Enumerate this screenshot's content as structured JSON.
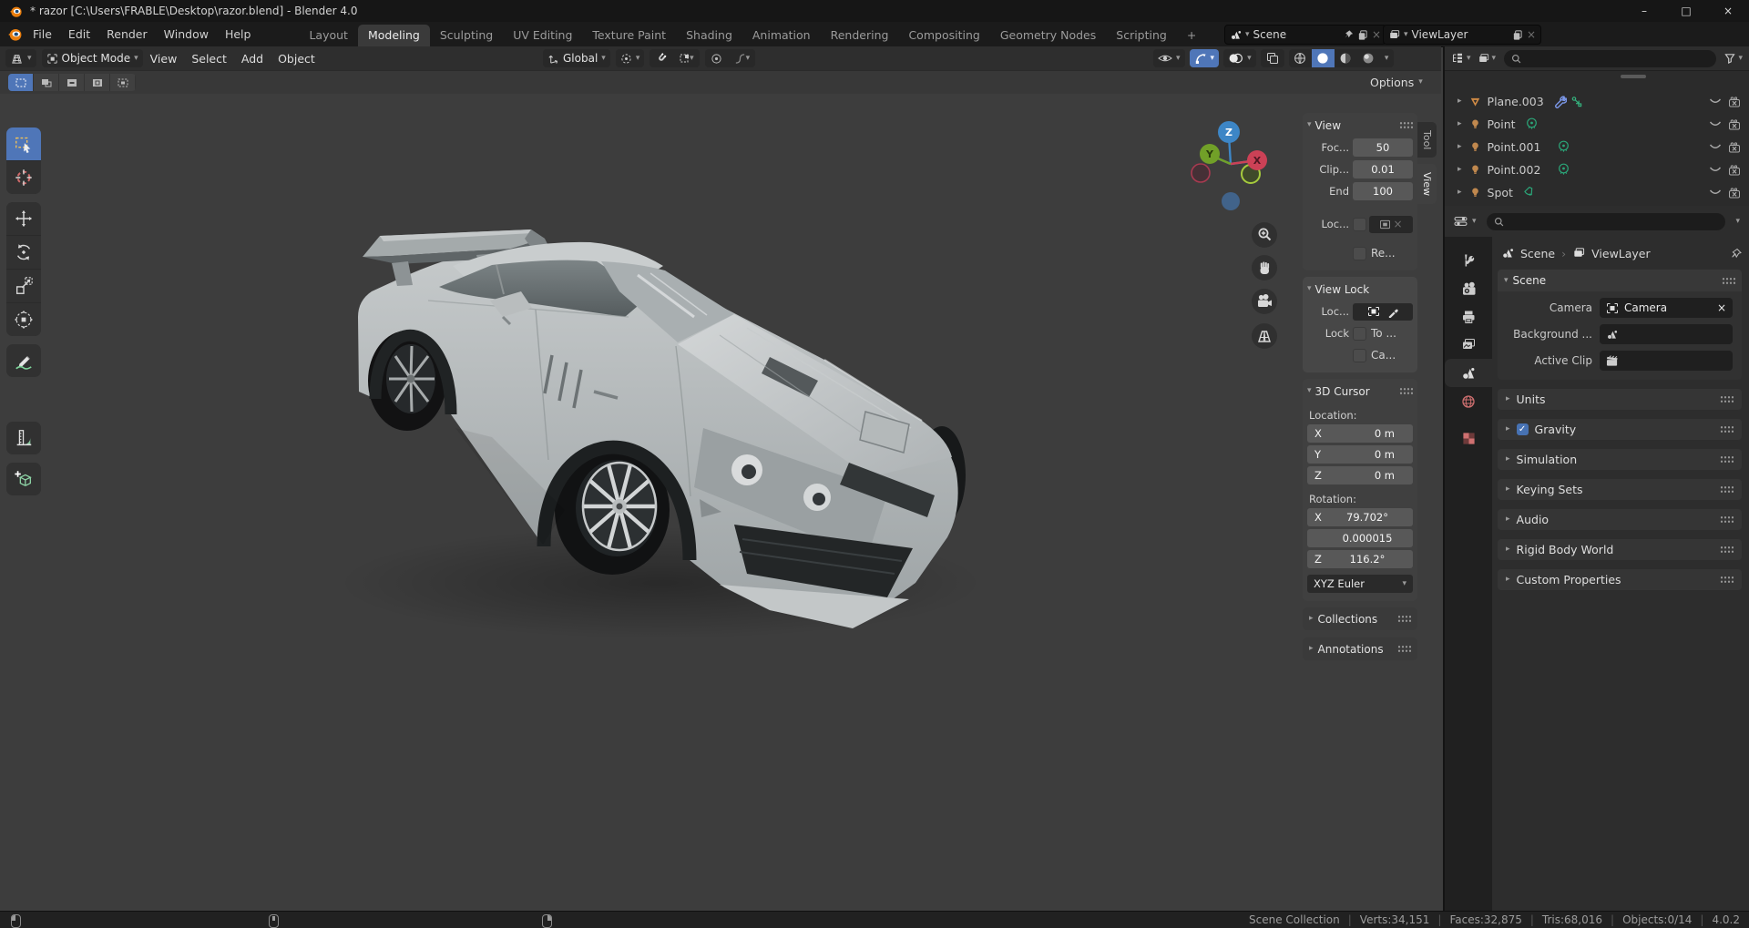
{
  "icons": {
    "chevron_down": "▾",
    "disclosure_right": "▸",
    "disclosure_down": "▾",
    "breadcrumb_separator": "›",
    "close": "×",
    "plus_tab": "+",
    "minimize": "–",
    "maximize": "□",
    "check": "✓",
    "statusbar_separator": "|"
  },
  "titlebar": {
    "title": "* razor [C:\\Users\\FRABLE\\Desktop\\razor.blend] - Blender 4.0"
  },
  "topbar": {
    "menus": [
      "File",
      "Edit",
      "Render",
      "Window",
      "Help"
    ],
    "workspaces": [
      "Layout",
      "Modeling",
      "Sculpting",
      "UV Editing",
      "Texture Paint",
      "Shading",
      "Animation",
      "Rendering",
      "Compositing",
      "Geometry Nodes",
      "Scripting"
    ],
    "active_workspace": "Modeling",
    "scene_selector": "Scene",
    "viewlayer_selector": "ViewLayer"
  },
  "tool_header": {
    "mode": "Object Mode",
    "menus": [
      "View",
      "Select",
      "Add",
      "Object"
    ],
    "orientation": "Global"
  },
  "tool_settings": {
    "options_label": "Options"
  },
  "viewport": {
    "sidebar_tabs": [
      "Tool",
      "View"
    ],
    "active_sidebar_tab": "View",
    "gizmo_axes": {
      "x": "X",
      "y": "Y",
      "z": "Z"
    }
  },
  "sidebar": {
    "view_panel": {
      "title": "View",
      "focal_label": "Foc...",
      "focal_value": "50",
      "clip_label": "Clip...",
      "clip_value": "0.01",
      "end_label": "End",
      "end_value": "100",
      "local_camera_label": "Loc...",
      "render_region_label": "Re..."
    },
    "view_lock_panel": {
      "title": "View Lock",
      "lock_object_label": "Loc...",
      "lock_label": "Lock",
      "to_3d_cursor_label": "To ...",
      "camera_to_view_label": "Ca..."
    },
    "cursor_panel": {
      "title": "3D Cursor",
      "location_label": "Location:",
      "location": [
        {
          "axis": "X",
          "value": "0 m"
        },
        {
          "axis": "Y",
          "value": "0 m"
        },
        {
          "axis": "Z",
          "value": "0 m"
        }
      ],
      "rotation_label": "Rotation:",
      "rotation": [
        {
          "axis": "X",
          "value": "79.702°"
        },
        {
          "axis": "",
          "value": "0.000015"
        },
        {
          "axis": "Z",
          "value": "116.2°"
        }
      ],
      "rotation_mode": "XYZ Euler"
    },
    "collections_panel": "Collections",
    "annotations_panel": "Annotations"
  },
  "outliner": {
    "items": [
      {
        "name": "Plane.003",
        "type": "mesh"
      },
      {
        "name": "Point",
        "type": "light"
      },
      {
        "name": "Point.001",
        "type": "light"
      },
      {
        "name": "Point.002",
        "type": "light"
      },
      {
        "name": "Spot",
        "type": "light"
      }
    ]
  },
  "properties": {
    "breadcrumb": {
      "scene": "Scene",
      "view_layer": "ViewLayer"
    },
    "scene_panel": {
      "title": "Scene",
      "camera_label": "Camera",
      "camera_value": "Camera",
      "background_label": "Background ...",
      "active_clip_label": "Active Clip"
    },
    "panels": [
      "Units",
      "Gravity",
      "Simulation",
      "Keying Sets",
      "Audio",
      "Rigid Body World",
      "Custom Properties"
    ]
  },
  "statusbar": {
    "items": [
      "Scene Collection",
      "Verts:34,151",
      "Faces:32,875",
      "Tris:68,016",
      "Objects:0/14",
      "4.0.2"
    ]
  },
  "colors": {
    "accent_blue": "#4772b3",
    "axis_x": "#cc4156",
    "axis_y": "#71a028",
    "axis_z": "#3d86c6",
    "mesh_orange": "#cf8a45",
    "light_data_green": "#2ba578"
  }
}
